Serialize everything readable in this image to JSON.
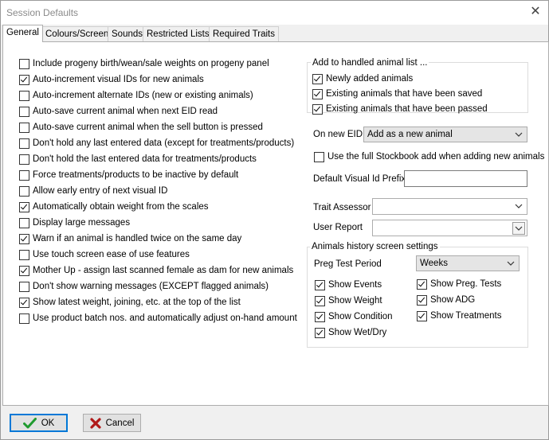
{
  "window": {
    "title": "Session Defaults",
    "close_icon": "close-icon"
  },
  "tabs": [
    {
      "label": "General",
      "active": true
    },
    {
      "label": "Colours/Screen",
      "active": false
    },
    {
      "label": "Sounds",
      "active": false
    },
    {
      "label": "Restricted Lists",
      "active": false
    },
    {
      "label": "Required Traits",
      "active": false
    }
  ],
  "left_options": [
    {
      "label": "Include progeny birth/wean/sale weights on progeny panel",
      "checked": false
    },
    {
      "label": "Auto-increment visual IDs for new animals",
      "checked": true
    },
    {
      "label": "Auto-increment alternate IDs (new or existing animals)",
      "checked": false
    },
    {
      "label": "Auto-save current animal when next EID read",
      "checked": false
    },
    {
      "label": "Auto-save current animal when the sell button is pressed",
      "checked": false
    },
    {
      "label": "Don't hold any last entered data (except for treatments/products)",
      "checked": false
    },
    {
      "label": "Don't hold the last entered data for treatments/products",
      "checked": false
    },
    {
      "label": "Force treatments/products to be inactive by default",
      "checked": false
    },
    {
      "label": "Allow early entry of next visual ID",
      "checked": false
    },
    {
      "label": "Automatically obtain weight from the scales",
      "checked": true
    },
    {
      "label": "Display large messages",
      "checked": false
    },
    {
      "label": "Warn if an animal is handled twice on the same day",
      "checked": true
    },
    {
      "label": "Use touch screen ease of use features",
      "checked": false
    },
    {
      "label": "Mother Up - assign last scanned female as dam for new animals",
      "checked": true
    },
    {
      "label": "Don't show warning messages (EXCEPT flagged animals)",
      "checked": false
    },
    {
      "label": "Show latest weight, joining, etc. at the top of the list",
      "checked": true
    },
    {
      "label": "Use product batch nos. and automatically adjust on-hand amount",
      "checked": false
    }
  ],
  "handled_list": {
    "title": "Add to handled animal list ...",
    "items": [
      {
        "label": "Newly added animals",
        "checked": true
      },
      {
        "label": "Existing animals that have been saved",
        "checked": true
      },
      {
        "label": "Existing animals that have been passed",
        "checked": true
      }
    ]
  },
  "on_new_eid": {
    "label": "On new EID",
    "value": "Add as a new animal"
  },
  "full_stockbook": {
    "label": "Use the full Stockbook add when adding new animals",
    "checked": false
  },
  "default_prefix": {
    "label": "Default Visual Id Prefix",
    "value": ""
  },
  "trait_assessor": {
    "label": "Trait Assessor",
    "value": ""
  },
  "user_report": {
    "label": "User Report",
    "value": ""
  },
  "history": {
    "title": "Animals history screen settings",
    "preg_label": "Preg Test Period",
    "preg_value": "Weeks",
    "left_items": [
      {
        "label": "Show Events",
        "checked": true
      },
      {
        "label": "Show Weight",
        "checked": true
      },
      {
        "label": "Show Condition",
        "checked": true
      },
      {
        "label": "Show Wet/Dry",
        "checked": true
      }
    ],
    "right_items": [
      {
        "label": "Show Preg. Tests",
        "checked": true
      },
      {
        "label": "Show ADG",
        "checked": true
      },
      {
        "label": "Show Treatments",
        "checked": true
      }
    ]
  },
  "buttons": {
    "ok": {
      "label": "OK",
      "icon": "checkmark-icon",
      "color": "#1f9a2e"
    },
    "cancel": {
      "label": "Cancel",
      "icon": "cross-icon",
      "color": "#b01818"
    }
  }
}
